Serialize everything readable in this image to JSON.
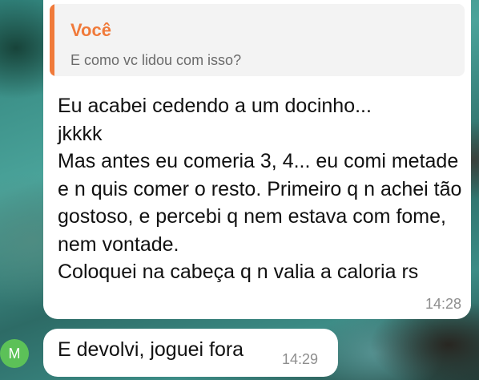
{
  "quoted_message": {
    "author": "Você",
    "text": "E como vc lidou com isso?"
  },
  "messages": [
    {
      "text": "Eu acabei cedendo a um docinho...\njkkkk\nMas antes eu comeria 3, 4... eu comi metade e n quis comer o resto. Primeiro q n achei tão gostoso, e percebi q nem estava com fome, nem vontade.\nColoquei na cabeça q n valia a caloria rs",
      "time": "14:28"
    },
    {
      "text": "E devolvi, joguei fora",
      "time": "14:29",
      "avatar_initial": "M"
    }
  ],
  "colors": {
    "reply_accent": "#f07a3a",
    "avatar": "#5cc158"
  }
}
